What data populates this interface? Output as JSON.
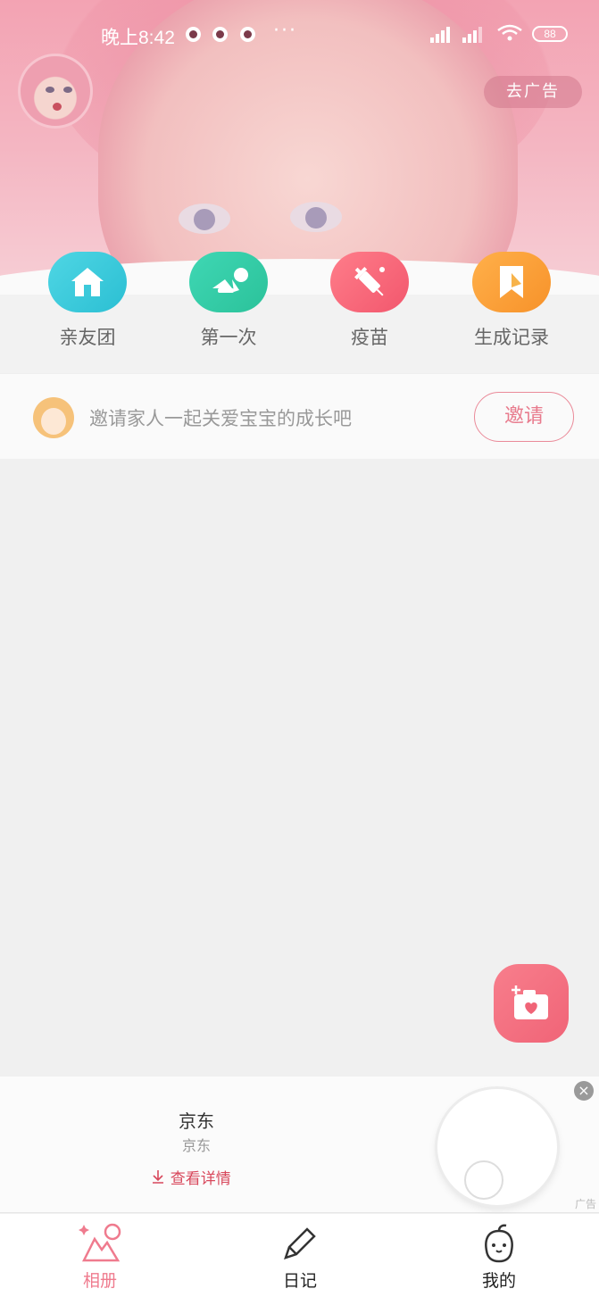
{
  "status_bar": {
    "time": "晚上8:42",
    "dots": "···",
    "battery": "88"
  },
  "header": {
    "ad_button": "去广告"
  },
  "quick_actions": [
    {
      "label": "亲友团",
      "icon": "house-icon"
    },
    {
      "label": "第一次",
      "icon": "crawling-baby-icon"
    },
    {
      "label": "疫苗",
      "icon": "syringe-icon"
    },
    {
      "label": "生成记录",
      "icon": "bookmark-icon"
    }
  ],
  "invite": {
    "text": "邀请家人一起关爱宝宝的成长吧",
    "button": "邀请"
  },
  "ad": {
    "title": "京东",
    "subtitle": "京东",
    "detail": "查看详情",
    "tag": "广告",
    "close": "×"
  },
  "tabs": [
    {
      "label": "相册",
      "icon": "album-icon",
      "active": true
    },
    {
      "label": "日记",
      "icon": "pencil-icon",
      "active": false
    },
    {
      "label": "我的",
      "icon": "profile-icon",
      "active": false
    }
  ],
  "colors": {
    "accent": "#ef7b8e",
    "header_pink": "#f3a3b3",
    "teal": "#2bbfd3",
    "green": "#2bc29a",
    "red": "#f2576d",
    "orange": "#f7922a"
  }
}
